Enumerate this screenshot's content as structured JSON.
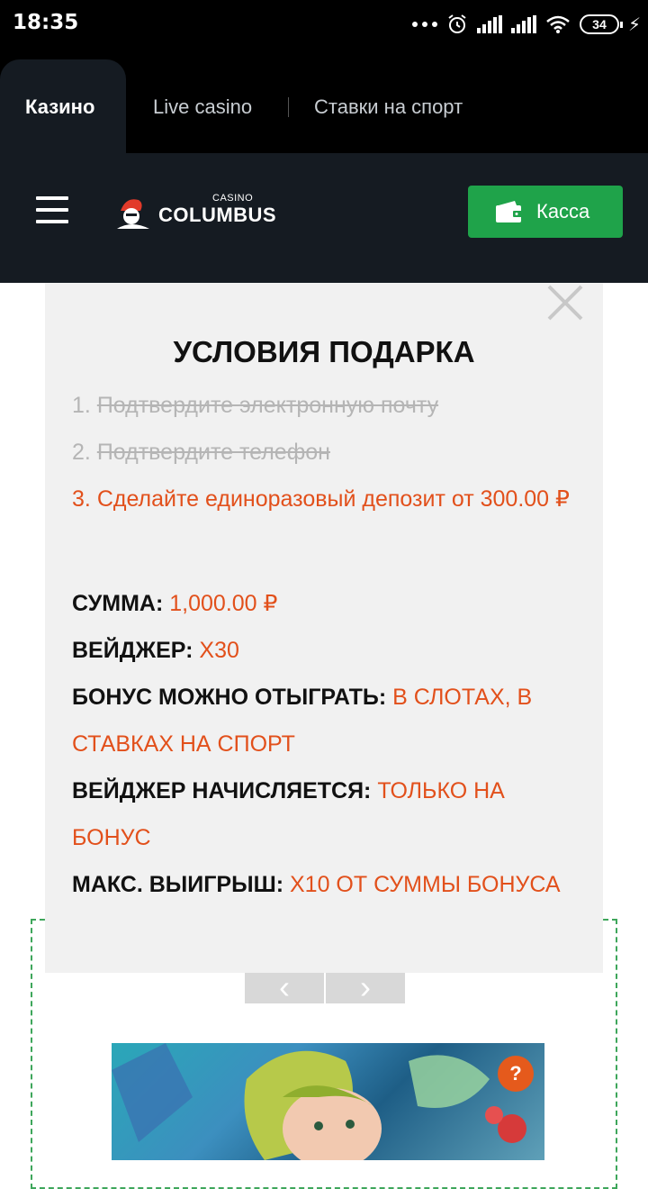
{
  "status_bar": {
    "time": "18:35",
    "battery": "34"
  },
  "top_nav": {
    "tabs": [
      {
        "label": "Казино",
        "active": true
      },
      {
        "label": "Live casino",
        "active": false
      },
      {
        "label": "Ставки на спорт",
        "active": false
      }
    ]
  },
  "header": {
    "logo_small": "CASINO",
    "logo_main": "COLUMBUS",
    "cashier_label": "Касса",
    "cashier_color": "#1fa34a"
  },
  "modal": {
    "title": "УСЛОВИЯ ПОДАРКА",
    "conditions": [
      {
        "num": "1.",
        "text": "Подтвердите электронную почту",
        "done": true
      },
      {
        "num": "2.",
        "text": "Подтвердите телефон",
        "done": true
      },
      {
        "num": "3.",
        "text": "Сделайте единоразовый депозит от 300.00 ₽",
        "done": false
      }
    ],
    "details": [
      {
        "label": "СУММА:",
        "value": "1,000.00 ₽"
      },
      {
        "label": "ВЕЙДЖЕР:",
        "value": "X30"
      },
      {
        "label": "БОНУС МОЖНО ОТЫГРАТЬ:",
        "value": "В СЛОТАХ, В СТАВКАХ НА СПОРТ"
      },
      {
        "label": "ВЕЙДЖЕР НАЧИСЛЯЕТСЯ:",
        "value": "ТОЛЬКО НА БОНУС"
      },
      {
        "label": "МАКС. ВЫИГРЫШ:",
        "value": "X10 ОТ СУММЫ БОНУСА"
      }
    ],
    "accent_color": "#e2501b"
  },
  "carousel": {
    "prev_icon": "chevron-left-icon",
    "next_icon": "chevron-right-icon"
  },
  "help_button": {
    "label": "?"
  }
}
